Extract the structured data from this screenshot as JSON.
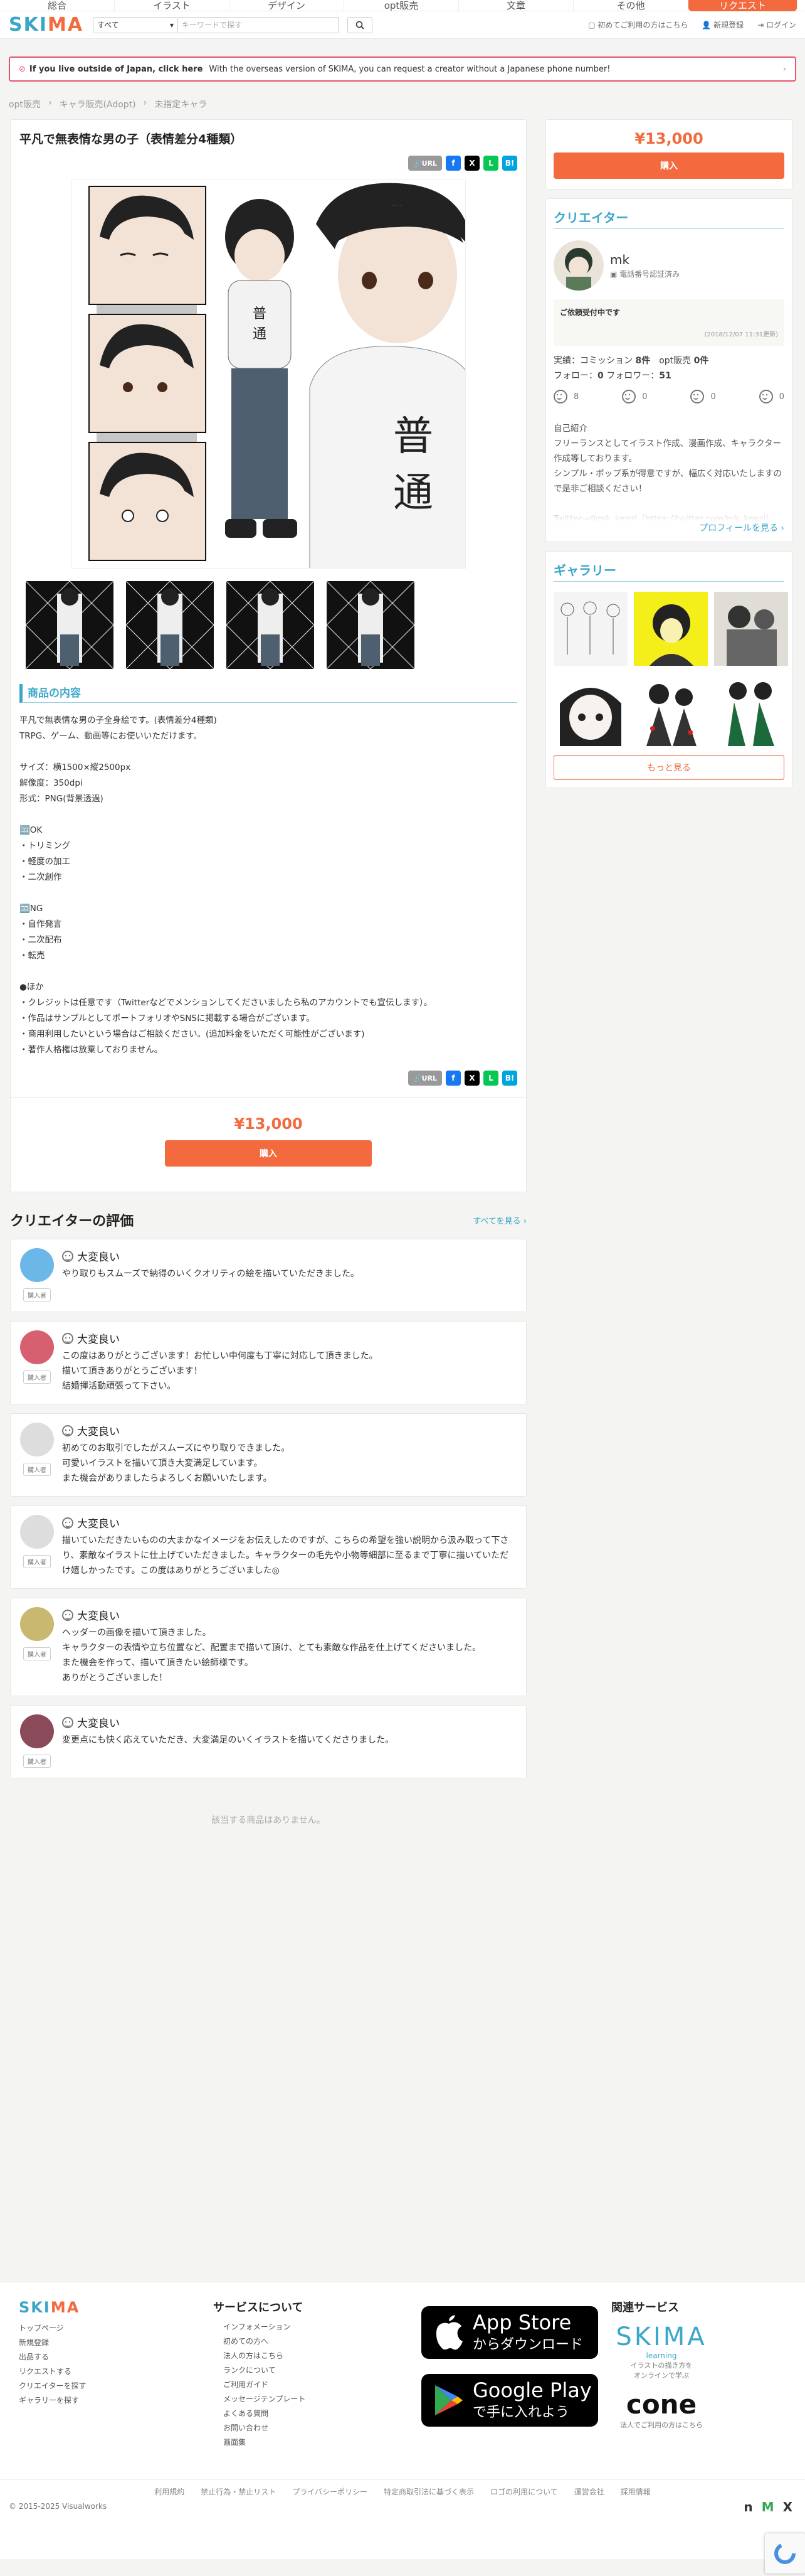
{
  "topnav": {
    "items": [
      "総合",
      "イラスト",
      "デザイン",
      "opt販売",
      "文章",
      "その他"
    ],
    "request": "リクエスト"
  },
  "header": {
    "logo_a": "SKI",
    "logo_b": "MA",
    "category": "すべて",
    "keyword_placeholder": "キーワードで探す",
    "links": [
      "初めてご利用の方はこちら",
      "新規登録",
      "ログイン"
    ]
  },
  "banner": {
    "strong": "If you live outside of Japan, click here",
    "text": "With the overseas version of SKIMA, you can request a creator without a Japanese phone number!"
  },
  "breadcrumb": [
    "opt販売",
    "キャラ販売(Adopt)",
    "未指定キャラ"
  ],
  "product": {
    "title": "平凡で無表情な男の子（表情差分4種類）",
    "url_label": "URL",
    "price": "¥13,000",
    "buy": "購入",
    "section": "商品の内容",
    "hero_text": "普通",
    "description": "平凡で無表情な男の子全身絵です。(表情差分4種類)\nTRPG、ゲーム、動画等にお使いいただけます。\n\nサイズ：横1500×縦2500px\n解像度：350dpi\n形式：PNG(背景透過)\n\n🈁OK\n・トリミング\n・軽度の加工\n・二次創作\n\n🈁NG\n・自作発言\n・二次配布\n・転売\n\n●ほか\n・クレジットは任意です（Twitterなどでメンションしてくださいましたら私のアカウントでも宣伝します）。\n・作品はサンプルとしてポートフォリオやSNSに掲載する場合がございます。\n・商用利用したいという場合はご相談ください。(追加料金をいただく可能性がございます)\n・著作人格権は放棄しておりません。"
  },
  "reviews": {
    "title": "クリエイターの評価",
    "see_all": "すべてを見る ›",
    "buyer": "購入者",
    "items": [
      {
        "rating": "大変良い",
        "text": "やり取りもスムーズで納得のいくクオリティの絵を描いていただきました。",
        "avatar": "#6bb8e8"
      },
      {
        "rating": "大変良い",
        "text": "この度はありがとうございます！お忙しい中何度も丁寧に対応して頂きました。\n描いて頂きありがとうございます！\n結婚揮活動頑張って下さい。",
        "avatar": "#d76070"
      },
      {
        "rating": "大変良い",
        "text": "初めてのお取引でしたがスムーズにやり取りできました。\n可愛いイラストを描いて頂き大変満足しています。\nまた機会がありましたらよろしくお願いいたします。",
        "avatar": "#dddddd"
      },
      {
        "rating": "大変良い",
        "text": "描いていただきたいものの大まかなイメージをお伝えしたのですが、こちらの希望を強い説明から汲み取って下さり、素敵なイラストに仕上げていただきました。キャラクターの毛先や小物等細部に至るまで丁寧に描いていただけ嬉しかったです。この度はありがとうございました◎",
        "avatar": "#dddddd"
      },
      {
        "rating": "大変良い",
        "text": "ヘッダーの画像を描いて頂きました。\nキャラクターの表情や立ち位置など、配置まで描いて頂け、とても素敵な作品を仕上げてくださいました。\nまた機会を作って、描いて頂きたい絵師様です。\nありがとうございました！",
        "avatar": "#c8b870"
      },
      {
        "rating": "大変良い",
        "text": "変更点にも快く応えていただき、大変満足のいくイラストを描いてくださりました。",
        "avatar": "#8a4a5a"
      }
    ]
  },
  "related_none": "該当する商品はありません。",
  "side": {
    "price": "¥13,000",
    "buy": "購入",
    "creator": {
      "section": "クリエイター",
      "name": "mk",
      "verified": "電話番号認証済み",
      "accepting": "ご依頼受付中です",
      "date": "(2018/12/07 11:31更新)",
      "stats1_a": "実績：コミッション ",
      "stats1_b": "8件",
      "stats1_c": "　opt販売 ",
      "stats1_d": "0件",
      "stats2_a": "フォロー：",
      "stats2_b": "0",
      "stats2_c": " フォロワー：",
      "stats2_d": "51",
      "ratings": [
        "8",
        "0",
        "0",
        "0"
      ],
      "intro_label": "自己紹介",
      "intro": "フリーランスとしてイラスト作成、漫画作成、キャラクター作成等しております。\nシンプル・ポップ系が得意ですが、幅広く対応いたしますので是非ご相談ください！\n\nTwitter→@mk_kenzi（https://twitter.com/mk_kenzi）",
      "profile": "プロフィールを見る ›"
    },
    "gallery": {
      "section": "ギャラリー",
      "more": "もっと見る"
    }
  },
  "footer": {
    "logo_a": "SKI",
    "logo_b": "MA",
    "left": [
      "トップページ",
      "新規登録",
      "出品する",
      "リクエストする",
      "クリエイターを探す",
      "ギャラリーを探す"
    ],
    "about_title": "サービスについて",
    "about": [
      "インフォメーション",
      "初めての方へ",
      "法人の方はこちら",
      "ランクについて",
      "ご利用ガイド",
      "メッセージテンプレート",
      "よくある質問",
      "お問い合わせ",
      "画面集"
    ],
    "app_top": "App Store",
    "app_bottom": "からダウンロード",
    "gp_top": "Google Play",
    "gp_bottom": "で手に入れよう",
    "related_title": "関連サービス",
    "sl_name": "SKIMA",
    "sl_sub": "learning",
    "sl_desc1": "イラストの描き方を",
    "sl_desc2": "オンラインで学ぶ",
    "cone": "cone",
    "cone_desc": "法人でご利用の方はこちら",
    "bottom": [
      "利用規約",
      "禁止行為・禁止リスト",
      "プライバシーポリシー",
      "特定商取引法に基づく表示",
      "ロゴの利用について",
      "運営会社",
      "採用情報"
    ],
    "copyright": "© 2015-2025 Visualworks"
  }
}
